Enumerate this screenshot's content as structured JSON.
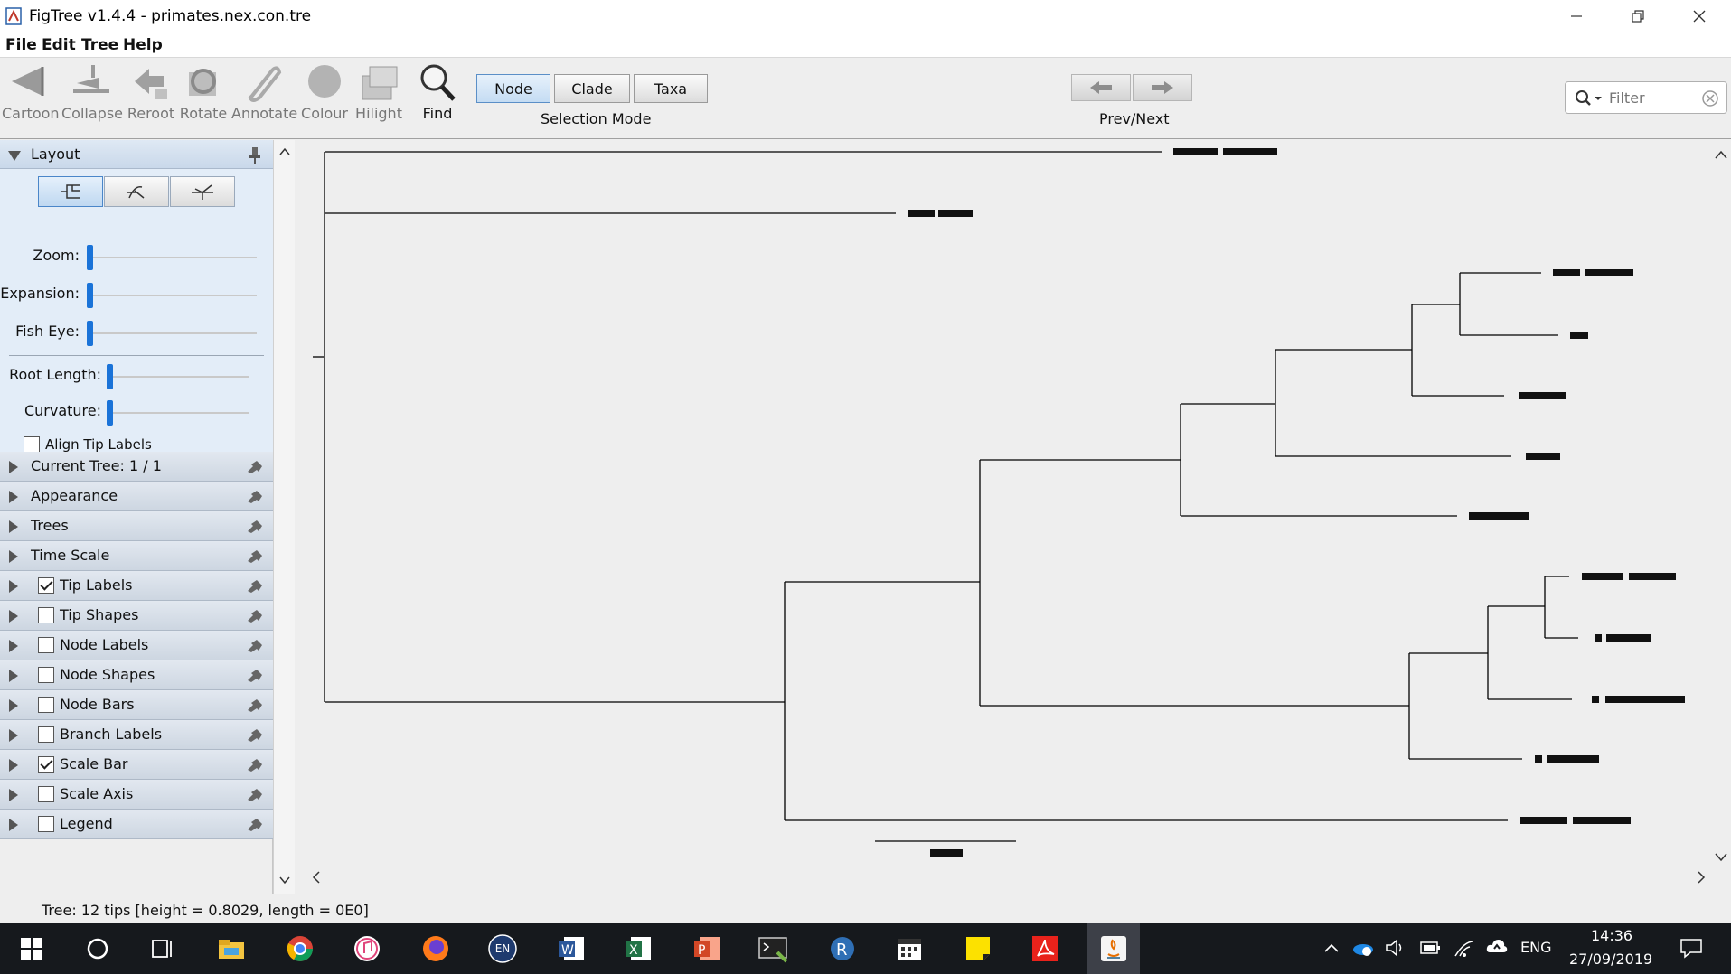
{
  "window": {
    "title": "FigTree v1.4.4 - primates.nex.con.tre"
  },
  "menu": [
    "File",
    "Edit",
    "Tree",
    "Help"
  ],
  "toolbar": {
    "tools": [
      {
        "label": "Cartoon",
        "icon": "cartoon-icon"
      },
      {
        "label": "Collapse",
        "icon": "collapse-icon"
      },
      {
        "label": "Reroot",
        "icon": "reroot-icon"
      },
      {
        "label": "Rotate",
        "icon": "rotate-icon"
      },
      {
        "label": "Annotate",
        "icon": "annotate-icon"
      },
      {
        "label": "Colour",
        "icon": "colour-icon"
      },
      {
        "label": "Hilight",
        "icon": "hilight-icon"
      },
      {
        "label": "Find",
        "icon": "find-icon"
      }
    ],
    "selection_modes": [
      "Node",
      "Clade",
      "Taxa"
    ],
    "selected_mode": "Node",
    "selection_caption": "Selection Mode",
    "prevnext_caption": "Prev/Next",
    "filter_placeholder": "Filter"
  },
  "layout_panel": {
    "title": "Layout",
    "sliders": [
      {
        "label": "Zoom:",
        "value": 0
      },
      {
        "label": "Expansion:",
        "value": 0
      },
      {
        "label": "Fish Eye:",
        "value": 0
      },
      {
        "label": "Root Length:",
        "value": 0
      },
      {
        "label": "Curvature:",
        "value": 0
      }
    ],
    "align_tip_labels": {
      "label": "Align Tip Labels",
      "checked": false
    }
  },
  "sections": [
    {
      "label": "Current Tree: 1 / 1",
      "checkbox": null
    },
    {
      "label": "Appearance",
      "checkbox": null
    },
    {
      "label": "Trees",
      "checkbox": null
    },
    {
      "label": "Time Scale",
      "checkbox": null
    },
    {
      "label": "Tip Labels",
      "checkbox": true
    },
    {
      "label": "Tip Shapes",
      "checkbox": false
    },
    {
      "label": "Node Labels",
      "checkbox": false
    },
    {
      "label": "Node Shapes",
      "checkbox": false
    },
    {
      "label": "Node Bars",
      "checkbox": false
    },
    {
      "label": "Branch Labels",
      "checkbox": false
    },
    {
      "label": "Scale Bar",
      "checkbox": true
    },
    {
      "label": "Scale Axis",
      "checkbox": false
    },
    {
      "label": "Legend",
      "checkbox": false
    }
  ],
  "status": "Tree: 12 tips [height = 0.8029, length = 0E0]",
  "taskbar": {
    "language": "EN",
    "input_lang": "ENG",
    "time": "14:36",
    "date": "27/09/2019"
  },
  "colors": {
    "accent": "#1a73d8",
    "taskbar": "#16191d",
    "panel_header": "#c9d8ea"
  }
}
